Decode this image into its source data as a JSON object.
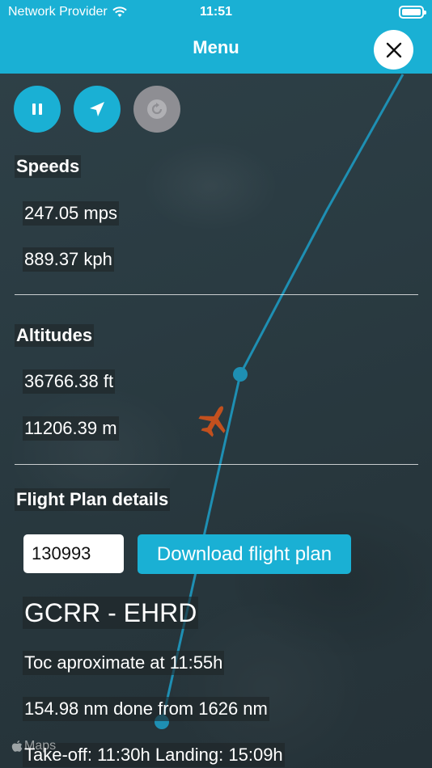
{
  "status_bar": {
    "carrier": "Network Provider",
    "time": "11:51"
  },
  "nav": {
    "title": "Menu"
  },
  "controls": [
    {
      "name": "pause-button",
      "icon": "pause-icon",
      "enabled": true
    },
    {
      "name": "locate-button",
      "icon": "location-arrow-icon",
      "enabled": true
    },
    {
      "name": "refresh-button",
      "icon": "refresh-icon",
      "enabled": false
    }
  ],
  "speeds": {
    "heading": "Speeds",
    "mps": "247.05 mps",
    "kph": "889.37 kph"
  },
  "altitudes": {
    "heading": "Altitudes",
    "ft": "36766.38 ft",
    "m": "11206.39 m"
  },
  "flight_plan": {
    "heading": "Flight Plan details",
    "input_value": "130993",
    "download_label": "Download flight plan",
    "route": "GCRR - EHRD",
    "toc": "Toc aproximate at 11:55h",
    "distance": "154.98 nm done from 1626 nm",
    "times": "Take-off: 11:30h Landing: 15:09h"
  },
  "map": {
    "attribution": "Maps"
  },
  "colors": {
    "accent": "#1ab0d4",
    "route_line": "#1e8fb3",
    "aircraft": "#c2501e",
    "disabled": "#8e8e93"
  }
}
